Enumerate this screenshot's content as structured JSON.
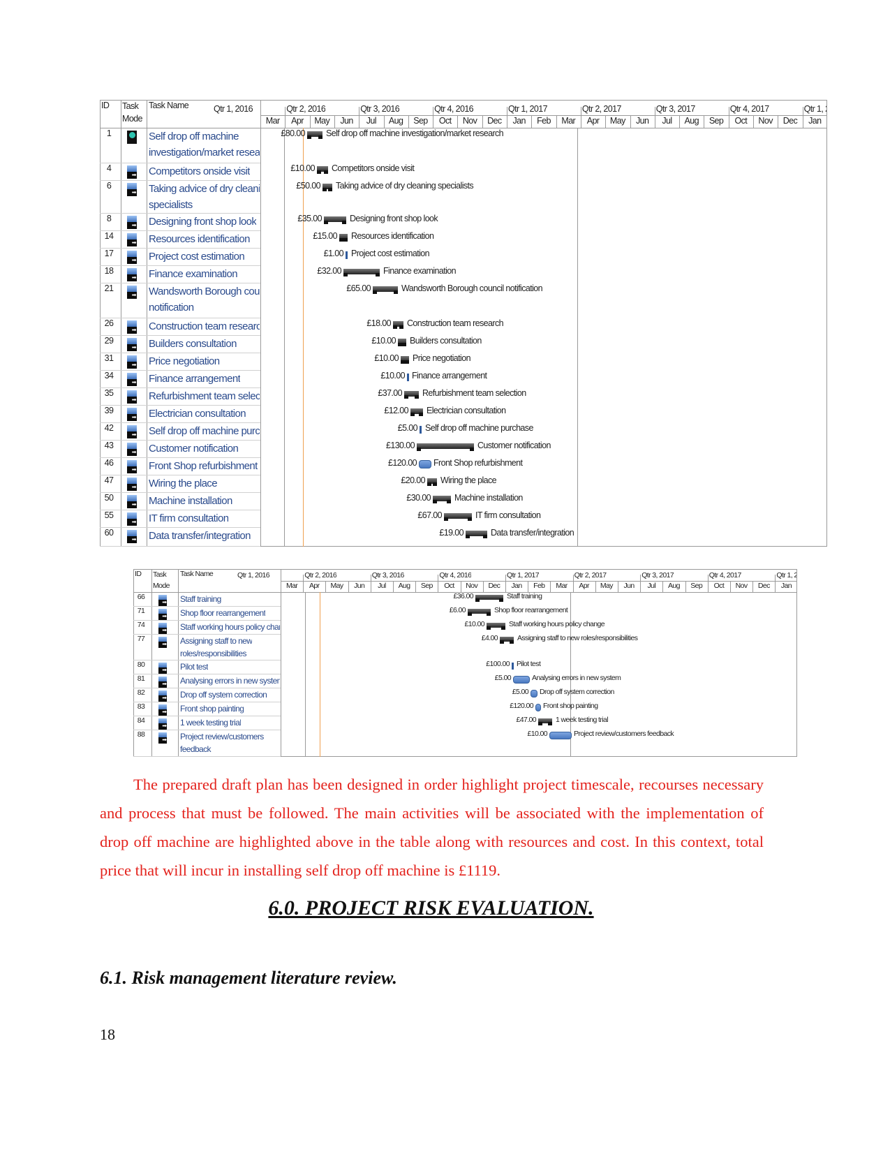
{
  "gantt_top": {
    "header": {
      "id": "ID",
      "mode": "Task Mode",
      "name": "Task Name",
      "qtr_first": "Qtr 1, 2016"
    },
    "quarters": [
      "Qtr 2, 2016",
      "Qtr 3, 2016",
      "Qtr 4, 2016",
      "Qtr 1, 2017",
      "Qtr 2, 2017",
      "Qtr 3, 2017",
      "Qtr 4, 2017",
      "Qtr 1, 2"
    ],
    "months": [
      "Mar",
      "Apr",
      "May",
      "Jun",
      "Jul",
      "Aug",
      "Sep",
      "Oct",
      "Nov",
      "Dec",
      "Jan",
      "Feb",
      "Mar",
      "Apr",
      "May",
      "Jun",
      "Jul",
      "Aug",
      "Sep",
      "Oct",
      "Nov",
      "Dec",
      "Jan"
    ],
    "tasks": [
      {
        "id": "1",
        "mode_icon": "manual-pin-icon",
        "name": [
          "Self drop off machine",
          "investigation/market research"
        ],
        "cost": "£80.00",
        "bar_label": "Self drop off machine investigation/market research"
      },
      {
        "id": "4",
        "mode_icon": "auto-schedule-icon",
        "name": [
          "Competitors onside visit"
        ],
        "cost": "£10.00",
        "bar_label": "Competitors onside visit"
      },
      {
        "id": "6",
        "mode_icon": "auto-schedule-icon",
        "name": [
          "Taking advice of dry cleaning",
          "specialists"
        ],
        "cost": "£50.00",
        "bar_label": "Taking advice of dry cleaning specialists"
      },
      {
        "id": "8",
        "mode_icon": "auto-schedule-icon",
        "name": [
          "Designing front shop look"
        ],
        "cost": "£35.00",
        "bar_label": "Designing front shop look"
      },
      {
        "id": "14",
        "mode_icon": "auto-schedule-icon",
        "name": [
          "Resources identification"
        ],
        "cost": "£15.00",
        "bar_label": "Resources identification"
      },
      {
        "id": "17",
        "mode_icon": "auto-schedule-icon",
        "name": [
          "Project cost estimation"
        ],
        "cost": "£1.00",
        "bar_label": "Project cost estimation"
      },
      {
        "id": "18",
        "mode_icon": "auto-schedule-icon",
        "name": [
          "Finance examination"
        ],
        "cost": "£32.00",
        "bar_label": "Finance examination"
      },
      {
        "id": "21",
        "mode_icon": "auto-schedule-icon",
        "name": [
          "Wandsworth Borough council",
          "notification"
        ],
        "cost": "£65.00",
        "bar_label": "Wandsworth Borough council notification"
      },
      {
        "id": "26",
        "mode_icon": "auto-schedule-icon",
        "name": [
          "Construction team research"
        ],
        "cost": "£18.00",
        "bar_label": "Construction team research"
      },
      {
        "id": "29",
        "mode_icon": "auto-schedule-icon",
        "name": [
          "Builders consultation"
        ],
        "cost": "£10.00",
        "bar_label": "Builders consultation"
      },
      {
        "id": "31",
        "mode_icon": "auto-schedule-icon",
        "name": [
          "Price negotiation"
        ],
        "cost": "£10.00",
        "bar_label": "Price negotiation"
      },
      {
        "id": "34",
        "mode_icon": "auto-schedule-icon",
        "name": [
          "Finance arrangement"
        ],
        "cost": "£10.00",
        "bar_label": "Finance arrangement"
      },
      {
        "id": "35",
        "mode_icon": "auto-schedule-icon",
        "name": [
          "Refurbishment team selection"
        ],
        "cost": "£37.00",
        "bar_label": "Refurbishment team selection"
      },
      {
        "id": "39",
        "mode_icon": "auto-schedule-icon",
        "name": [
          "Electrician consultation"
        ],
        "cost": "£12.00",
        "bar_label": "Electrician consultation"
      },
      {
        "id": "42",
        "mode_icon": "auto-schedule-icon",
        "name": [
          "Self drop off machine purchase"
        ],
        "cost": "£5.00",
        "bar_label": "Self drop off machine purchase"
      },
      {
        "id": "43",
        "mode_icon": "auto-schedule-icon",
        "name": [
          "Customer notification"
        ],
        "cost": "£130.00",
        "bar_label": "Customer notification"
      },
      {
        "id": "46",
        "mode_icon": "auto-schedule-icon",
        "name": [
          "Front Shop refurbishment"
        ],
        "cost": "£120.00",
        "bar_label": "Front Shop refurbishment"
      },
      {
        "id": "47",
        "mode_icon": "auto-schedule-icon",
        "name": [
          "Wiring the place"
        ],
        "cost": "£20.00",
        "bar_label": "Wiring the place"
      },
      {
        "id": "50",
        "mode_icon": "auto-schedule-icon",
        "name": [
          "Machine installation"
        ],
        "cost": "£30.00",
        "bar_label": "Machine installation"
      },
      {
        "id": "55",
        "mode_icon": "auto-schedule-icon",
        "name": [
          "IT firm consultation"
        ],
        "cost": "£67.00",
        "bar_label": "IT firm consultation"
      },
      {
        "id": "60",
        "mode_icon": "auto-schedule-icon",
        "name": [
          "Data transfer/integration"
        ],
        "cost": "£19.00",
        "bar_label": "Data transfer/integration"
      }
    ]
  },
  "gantt_bottom": {
    "header": {
      "id": "ID",
      "mode": "Task Mode",
      "name": "Task Name",
      "qtr_first": "Qtr 1, 2016"
    },
    "quarters": [
      "Qtr 2, 2016",
      "Qtr 3, 2016",
      "Qtr 4, 2016",
      "Qtr 1, 2017",
      "Qtr 2, 2017",
      "Qtr 3, 2017",
      "Qtr 4, 2017",
      "Qtr 1, 2"
    ],
    "months": [
      "Mar",
      "Apr",
      "May",
      "Jun",
      "Jul",
      "Aug",
      "Sep",
      "Oct",
      "Nov",
      "Dec",
      "Jan",
      "Feb",
      "Mar",
      "Apr",
      "May",
      "Jun",
      "Jul",
      "Aug",
      "Sep",
      "Oct",
      "Nov",
      "Dec",
      "Jan"
    ],
    "tasks": [
      {
        "id": "66",
        "mode_icon": "auto-schedule-icon",
        "name": [
          "Staff training"
        ],
        "cost": "£36.00",
        "bar_label": "Staff training"
      },
      {
        "id": "71",
        "mode_icon": "auto-schedule-icon",
        "name": [
          "Shop floor rearrangement"
        ],
        "cost": "£6.00",
        "bar_label": "Shop floor rearrangement"
      },
      {
        "id": "74",
        "mode_icon": "auto-schedule-icon",
        "name": [
          "Staff working hours policy chang"
        ],
        "cost": "£10.00",
        "bar_label": "Staff working hours policy change"
      },
      {
        "id": "77",
        "mode_icon": "auto-schedule-icon",
        "name": [
          "Assigning staff to new",
          "roles/responsibilities"
        ],
        "cost": "£4.00",
        "bar_label": "Assigning staff to new roles/responsibilities"
      },
      {
        "id": "80",
        "mode_icon": "auto-schedule-icon",
        "name": [
          "Pilot test"
        ],
        "cost": "£100.00",
        "bar_label": "Pilot test"
      },
      {
        "id": "81",
        "mode_icon": "auto-schedule-icon",
        "name": [
          "Analysing errors in new system"
        ],
        "cost": "£5.00",
        "bar_label": "Analysing errors in new system"
      },
      {
        "id": "82",
        "mode_icon": "auto-schedule-icon",
        "name": [
          "Drop off system correction"
        ],
        "cost": "£5.00",
        "bar_label": "Drop off system correction"
      },
      {
        "id": "83",
        "mode_icon": "auto-schedule-icon",
        "name": [
          "Front shop painting"
        ],
        "cost": "£120.00",
        "bar_label": "Front shop painting"
      },
      {
        "id": "84",
        "mode_icon": "auto-schedule-icon",
        "name": [
          "1 week testing trial"
        ],
        "cost": "£47.00",
        "bar_label": "1 week testing trial"
      },
      {
        "id": "88",
        "mode_icon": "auto-schedule-icon",
        "name": [
          "Project review/customers",
          "feedback"
        ],
        "cost": "£10.00",
        "bar_label": "Project review/customers feedback"
      }
    ]
  },
  "colors": {
    "task_name": "#2a4a8c",
    "body_text": "#e3221c",
    "today_line": "#f0a050"
  },
  "paragraph": "The prepared draft plan has been designed in order highlight project timescale, recourses necessary and process that must be followed. The main activities will be associated with the implementation of drop off machine are highlighted above in the table along with resources and cost. In this context, total price that will incur in installing self drop off machine is £1119.",
  "heading_section": "6.0. PROJECT RISK EVALUATION.",
  "heading_subsection": "6.1. Risk management literature review.",
  "page_number": "18"
}
